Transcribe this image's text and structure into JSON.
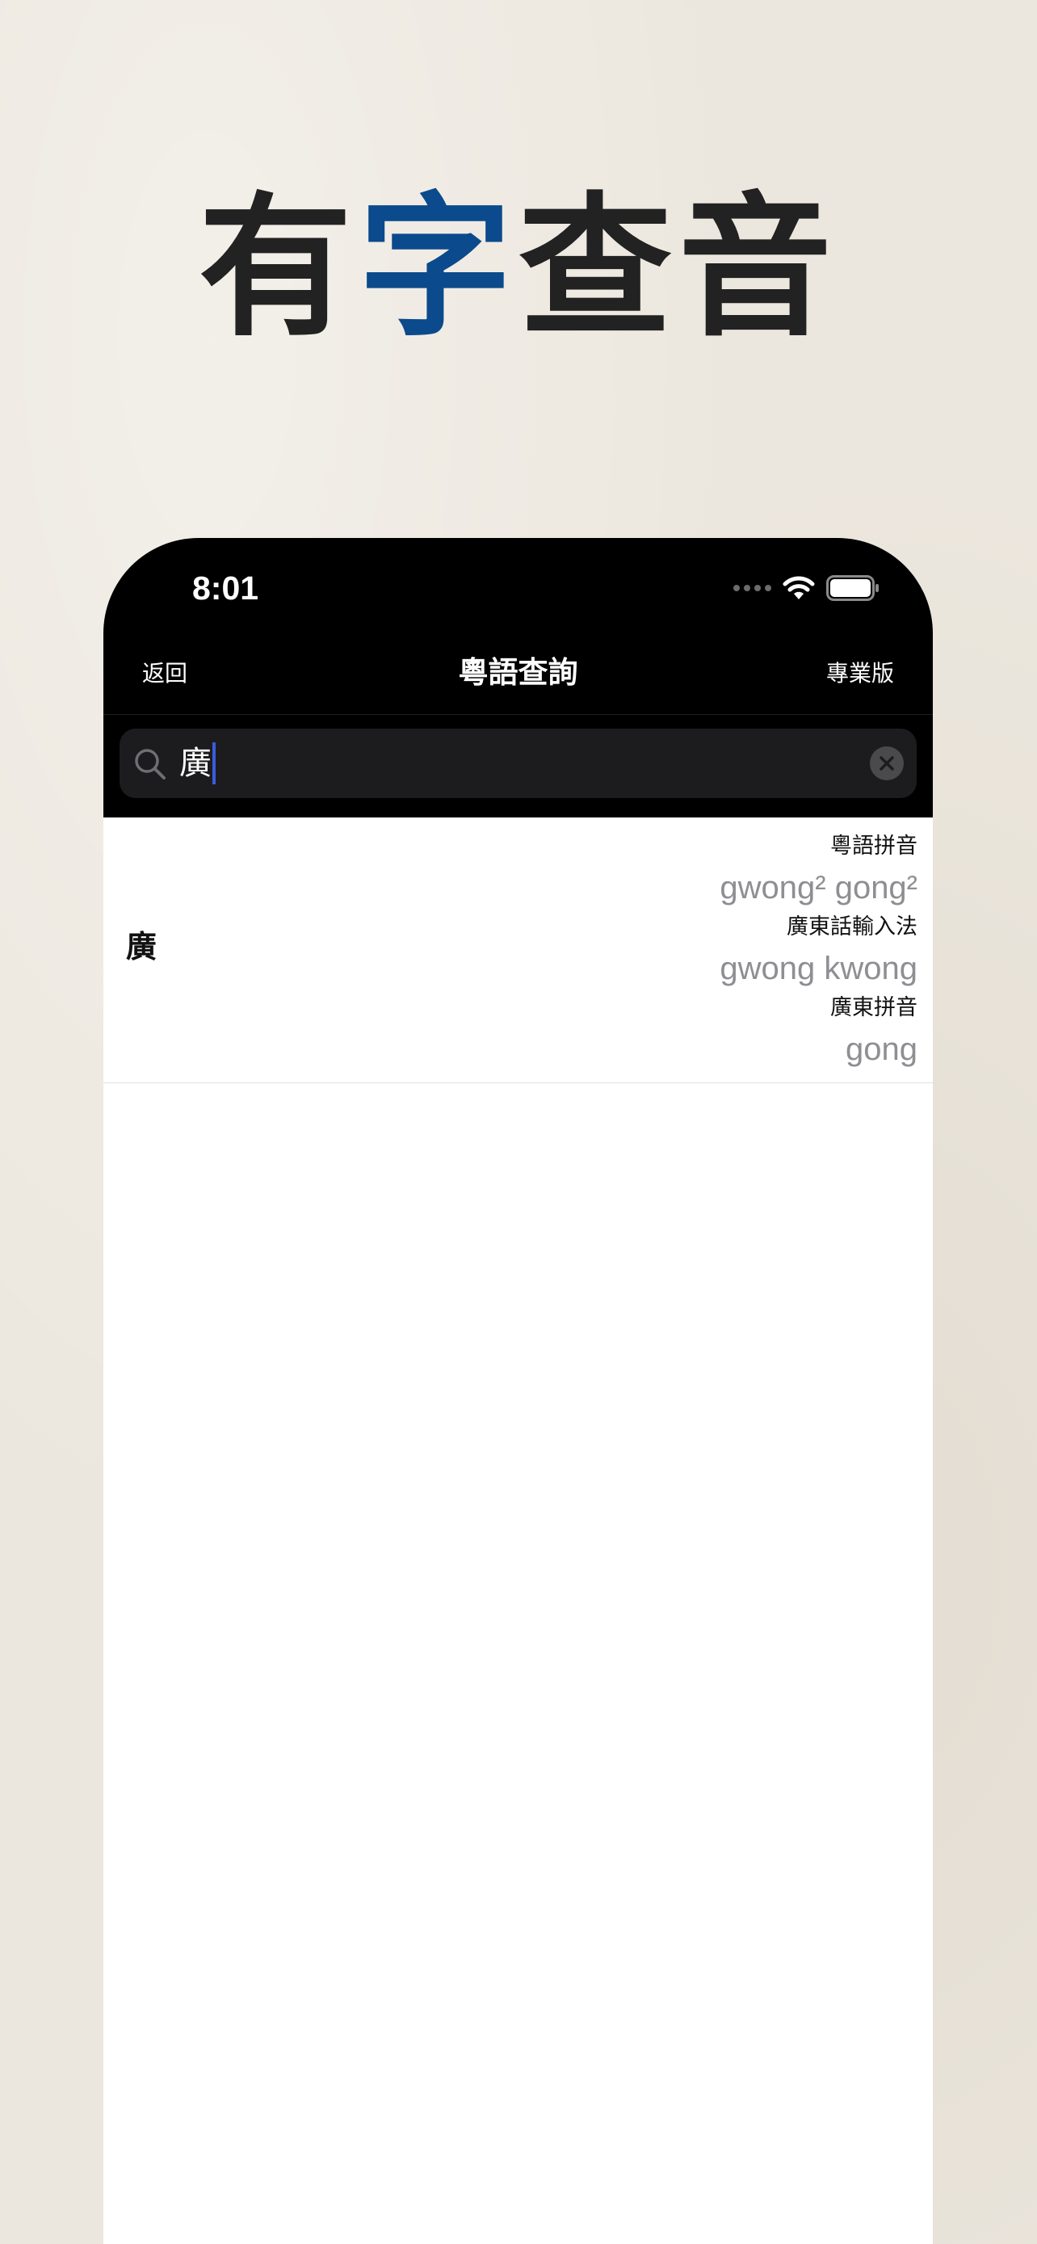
{
  "headline": {
    "part1": "有",
    "accent": "字",
    "part2": "查音",
    "accent_color": "#0b4a8c"
  },
  "status_bar": {
    "time": "8:01",
    "icons": [
      "signal-dots-icon",
      "wifi-icon",
      "battery-icon"
    ]
  },
  "nav": {
    "back_label": "返回",
    "title": "粵語查詢",
    "pro_label": "專業版"
  },
  "search": {
    "value": "廣",
    "icons": [
      "search-icon",
      "clear-icon"
    ]
  },
  "result": {
    "character": "廣",
    "readings": [
      {
        "label": "粵語拼音",
        "value": "gwong² gong²"
      },
      {
        "label": "廣東話輸入法",
        "value": "gwong kwong"
      },
      {
        "label": "廣東拼音",
        "value": "gong"
      }
    ]
  }
}
